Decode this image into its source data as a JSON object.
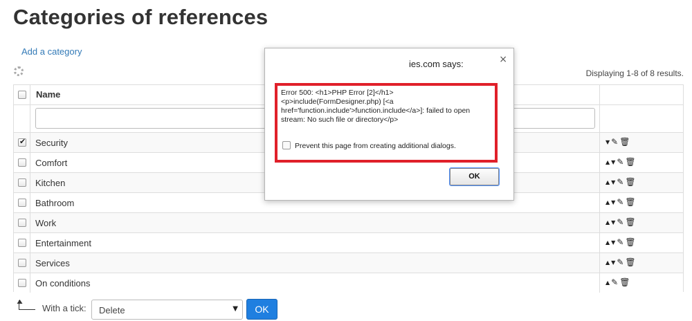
{
  "page": {
    "title": "Categories of references",
    "add_category": "Add a category",
    "summary": "Displaying 1-8 of 8 results."
  },
  "grid": {
    "header": {
      "name": "Name"
    },
    "filter_value": "",
    "rows": [
      {
        "label": "Security",
        "checked": true,
        "actions": [
          "down",
          "edit",
          "delete"
        ]
      },
      {
        "label": "Comfort",
        "checked": false,
        "actions": [
          "up",
          "down",
          "edit",
          "delete"
        ]
      },
      {
        "label": "Kitchen",
        "checked": false,
        "actions": [
          "up",
          "down",
          "edit",
          "delete"
        ]
      },
      {
        "label": "Bathroom",
        "checked": false,
        "actions": [
          "up",
          "down",
          "edit",
          "delete"
        ]
      },
      {
        "label": "Work",
        "checked": false,
        "actions": [
          "up",
          "down",
          "edit",
          "delete"
        ]
      },
      {
        "label": "Entertainment",
        "checked": false,
        "actions": [
          "up",
          "down",
          "edit",
          "delete"
        ]
      },
      {
        "label": "Services",
        "checked": false,
        "actions": [
          "up",
          "down",
          "edit",
          "delete"
        ]
      },
      {
        "label": "On conditions",
        "checked": false,
        "actions": [
          "up",
          "edit",
          "delete"
        ]
      }
    ]
  },
  "bulk": {
    "label": "With a tick:",
    "selected": "Delete",
    "ok": "OK"
  },
  "dialog": {
    "title": "ies.com says:",
    "message": "Error 500: <h1>PHP Error [2]</h1> <p>include(FormDesigner.php) [<a href='function.include'>function.include</a>]: failed to open stream: No such file or directory</p>",
    "prevent_label": "Prevent this page from creating additional dialogs.",
    "ok": "OK",
    "highlight_color": "#e0202a"
  },
  "icons": {
    "up": "▲",
    "down": "▼",
    "edit": "✎",
    "delete": "🗑",
    "close": "×"
  }
}
